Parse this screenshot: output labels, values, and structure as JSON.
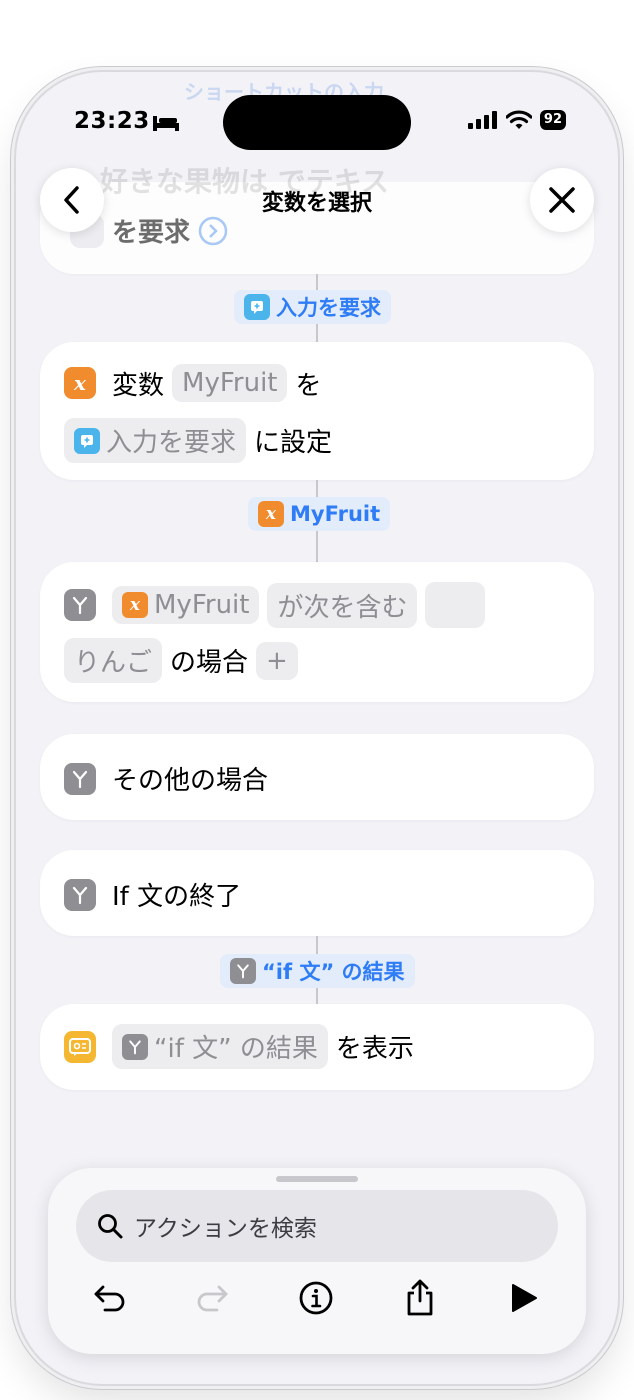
{
  "status": {
    "time": "23:23",
    "battery": "92"
  },
  "ghost": {
    "top": "ショートカットの入力",
    "mid": "好きな果物は でテキス",
    "behind": "を要求"
  },
  "nav": {
    "title": "変数を選択"
  },
  "connectors": {
    "ask_output": "入力を要求",
    "var_output": "MyFruit",
    "if_output": "“if 文” の結果"
  },
  "set_variable": {
    "prefix": "変数",
    "name": "MyFruit",
    "particle": "を",
    "value": "入力を要求",
    "suffix": "に設定"
  },
  "if_block": {
    "variable": "MyFruit",
    "condition": "が次を含む",
    "value": "りんご",
    "suffix": "の場合",
    "add": "+"
  },
  "otherwise": {
    "label": "その他の場合"
  },
  "end_if": {
    "label": "If 文の終了"
  },
  "show_result": {
    "token": "“if 文” の結果",
    "suffix": "を表示"
  },
  "search": {
    "placeholder": "アクションを検索"
  },
  "icons": {
    "back": "chevron-left-icon",
    "close": "close-icon",
    "variable": "variable-x-icon",
    "branch": "if-branch-icon",
    "ask": "ask-input-icon",
    "show": "show-result-icon",
    "search": "magnifier-icon",
    "undo": "undo-icon",
    "redo": "redo-icon",
    "info": "info-icon",
    "share": "share-icon",
    "play": "play-icon"
  },
  "colors": {
    "orange": "#f08c2e",
    "gray": "#8e8e93",
    "cyan": "#4bb4ea",
    "yellow": "#f5b731",
    "blue": "#2e7cf6"
  }
}
